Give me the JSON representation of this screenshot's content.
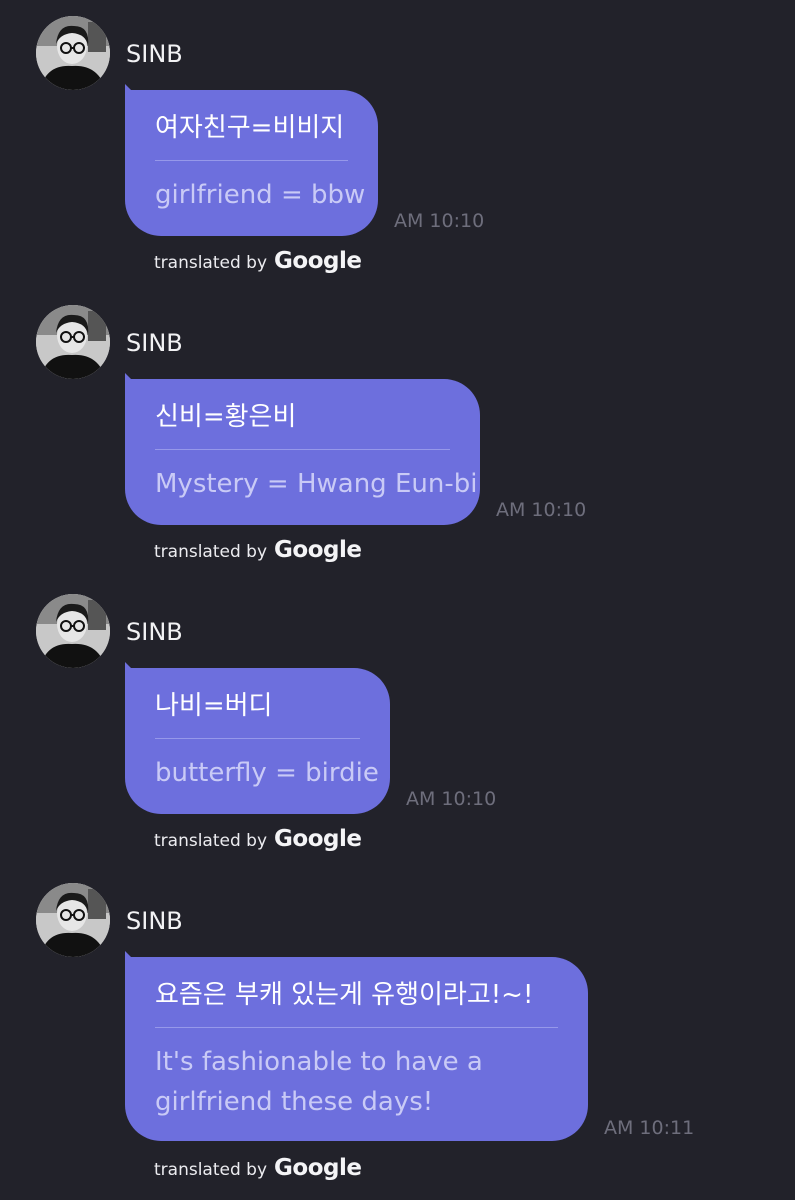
{
  "messages": [
    {
      "sender": "SINB",
      "original": "여자친구=비비지",
      "translation": "girlfriend = bbw",
      "time": "AM 10:10",
      "credit_text": "translated by",
      "credit_brand": "Google"
    },
    {
      "sender": "SINB",
      "original": "신비=황은비",
      "translation": "Mystery = Hwang Eun-bi",
      "time": "AM 10:10",
      "credit_text": "translated by",
      "credit_brand": "Google"
    },
    {
      "sender": "SINB",
      "original": "나비=버디",
      "translation": "butterfly = birdie",
      "time": "AM 10:10",
      "credit_text": "translated by",
      "credit_brand": "Google"
    },
    {
      "sender": "SINB",
      "original": "요즘은 부캐 있는게 유행이라고!~!",
      "translation_line1": "It's fashionable to have a",
      "translation_line2": "girlfriend these days!",
      "time": "AM 10:11",
      "credit_text": "translated by",
      "credit_brand": "Google"
    }
  ],
  "colors": {
    "background": "#22222a",
    "bubble": "#6d6fdd",
    "timestamp": "#6e6e7c"
  }
}
